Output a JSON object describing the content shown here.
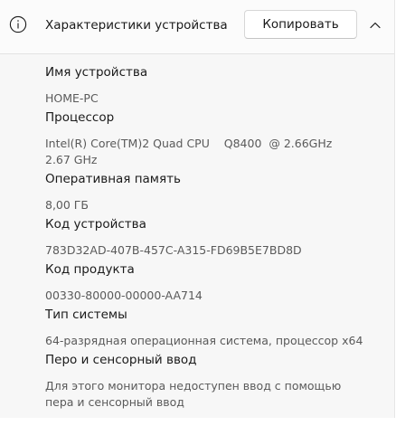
{
  "header": {
    "title": "Характеристики устройства",
    "copy_label": "Копировать",
    "icons": {
      "info": "info-icon",
      "collapse": "chevron-up-icon"
    }
  },
  "specs": [
    {
      "label": "Имя устройства",
      "value": "HOME-PC"
    },
    {
      "label": "Процессор",
      "value": "Intel(R) Core(TM)2 Quad CPU    Q8400  @ 2.66GHz\n2.67 GHz"
    },
    {
      "label": "Оперативная память",
      "value": "8,00 ГБ"
    },
    {
      "label": "Код устройства",
      "value": "783D32AD-407B-457C-A315-FD69B5E7BD8D"
    },
    {
      "label": "Код продукта",
      "value": "00330-80000-00000-AA714"
    },
    {
      "label": "Тип системы",
      "value": "64-разрядная операционная система, процессор x64"
    },
    {
      "label": "Перо и сенсорный ввод",
      "value": "Для этого монитора недоступен ввод с помощью\nпера и сенсорный ввод"
    }
  ],
  "colors": {
    "panel_background": "#f7f7f7",
    "header_background": "#fbfbfb",
    "label_text": "#1a1a1a",
    "value_text": "#5a5a5a"
  }
}
